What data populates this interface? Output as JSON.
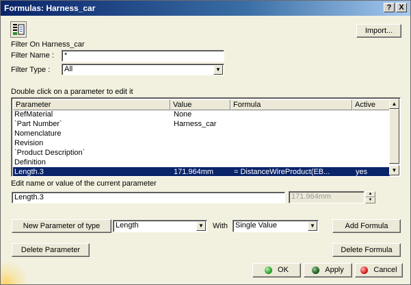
{
  "window": {
    "title": "Formulas: Harness_car",
    "help_btn": "?",
    "close_btn": "X"
  },
  "import_button": "Import...",
  "filter": {
    "heading": "Filter On Harness_car",
    "name_label": "Filter Name :",
    "name_value": "*",
    "type_label": "Filter Type :",
    "type_value": "All"
  },
  "table": {
    "instruction": "Double click on a parameter to edit it",
    "columns": [
      "Parameter",
      "Value",
      "Formula",
      "Active"
    ],
    "rows": [
      {
        "parameter": "RefMaterial",
        "value": "None",
        "formula": "",
        "active": ""
      },
      {
        "parameter": "`Part Number`",
        "value": "Harness_car",
        "formula": "",
        "active": ""
      },
      {
        "parameter": "Nomenclature",
        "value": "",
        "formula": "",
        "active": ""
      },
      {
        "parameter": "Revision",
        "value": "",
        "formula": "",
        "active": ""
      },
      {
        "parameter": "`Product Description`",
        "value": "",
        "formula": "",
        "active": ""
      },
      {
        "parameter": "Definition",
        "value": "",
        "formula": "",
        "active": ""
      },
      {
        "parameter": "Length.3",
        "value": "171.964mm",
        "formula": "= DistanceWireProduct(EB...",
        "active": "yes"
      }
    ],
    "selected_row": 6
  },
  "edit": {
    "label": "Edit name or value of the current parameter",
    "name_value": "Length.3",
    "value_value": "171.964mm"
  },
  "new_param": {
    "button": "New Parameter of type",
    "type_value": "Length",
    "with_label": "With",
    "with_value": "Single Value",
    "add_formula": "Add Formula"
  },
  "delete_parameter": "Delete Parameter",
  "delete_formula": "Delete Formula",
  "footer": {
    "ok": "OK",
    "apply": "Apply",
    "cancel": "Cancel"
  },
  "colors": {
    "titlebar": "#0a246a",
    "dialog_bg": "#f2f0de",
    "selection": "#0a246a",
    "ok_dot": "#2ea32e",
    "apply_dot": "#1f5f1f",
    "cancel_dot": "#d42020"
  },
  "icons": [
    "formula-filter-icon",
    "help-icon",
    "close-icon",
    "dropdown-arrow-icon",
    "scroll-up-icon",
    "scroll-down-icon",
    "spin-up-icon",
    "spin-down-icon"
  ]
}
